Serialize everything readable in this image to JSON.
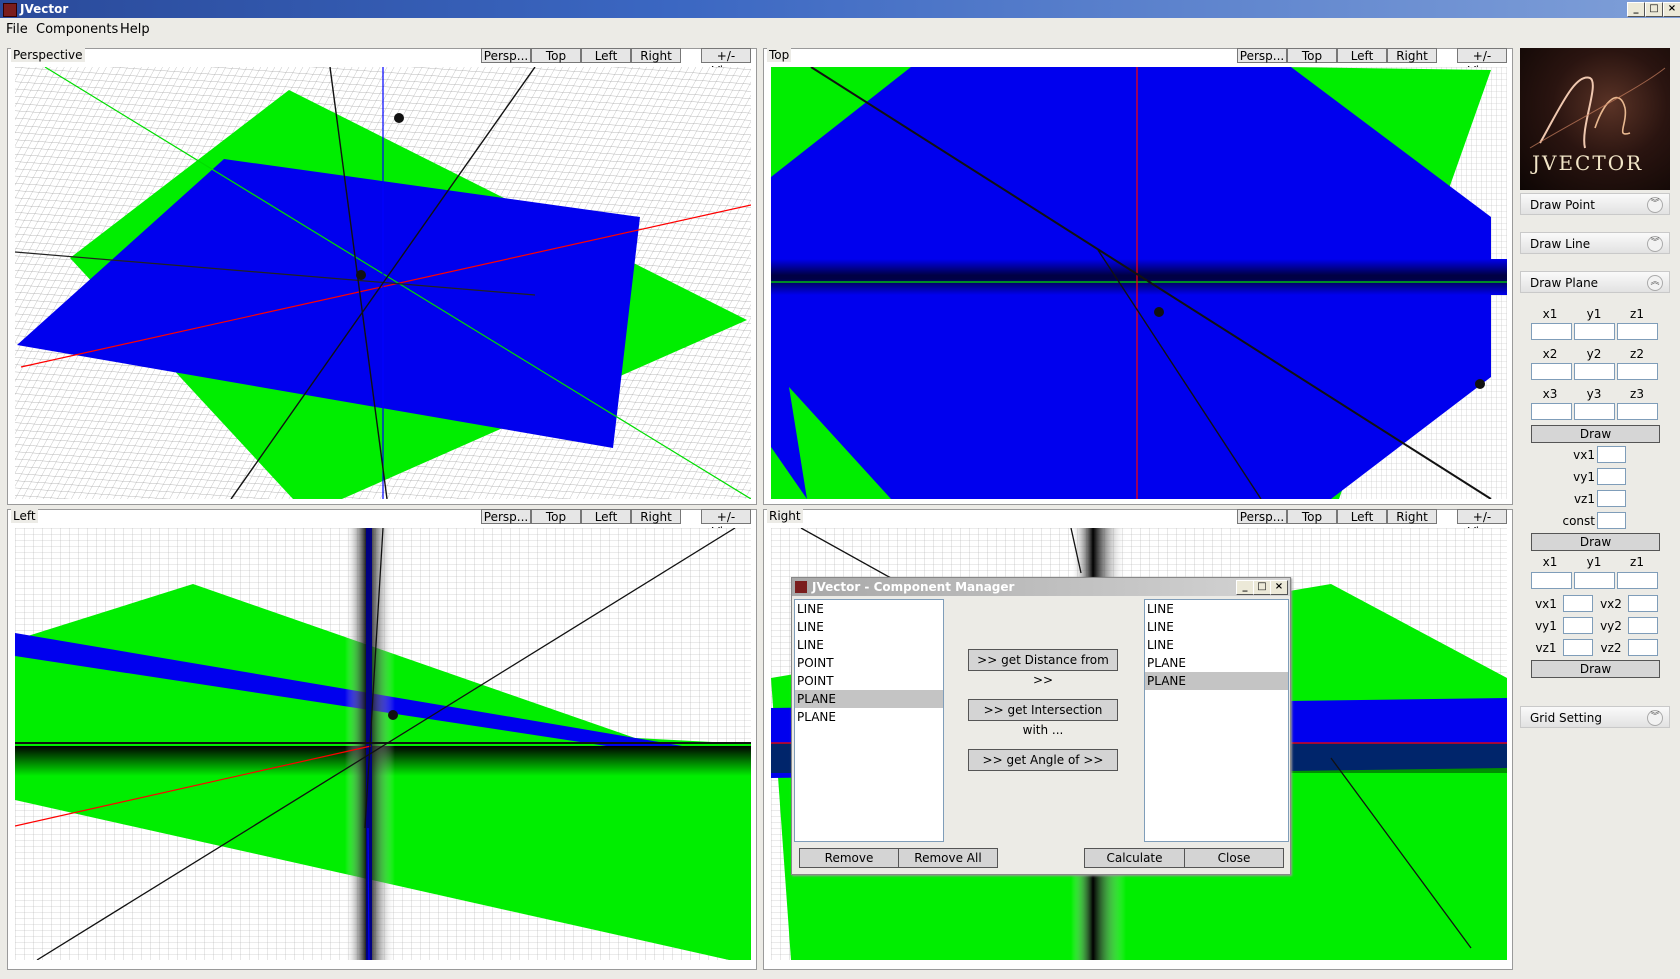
{
  "window": {
    "title": "JVector"
  },
  "menu": [
    "File",
    "Components",
    "Help"
  ],
  "viewports": [
    {
      "label": "Perspective",
      "buttons": [
        "Persp...",
        "Top",
        "Left",
        "Right"
      ],
      "toggle": "+/- View"
    },
    {
      "label": "Top",
      "buttons": [
        "Persp...",
        "Top",
        "Left",
        "Right"
      ],
      "toggle": "+/- View"
    },
    {
      "label": "Left",
      "buttons": [
        "Persp...",
        "Top",
        "Left",
        "Right"
      ],
      "toggle": "+/- View"
    },
    {
      "label": "Right",
      "buttons": [
        "Persp...",
        "Top",
        "Left",
        "Right"
      ],
      "toggle": "+/- View"
    }
  ],
  "sidebar": {
    "logo_text": "JVECTOR",
    "draw_point": "Draw Point",
    "draw_line": "Draw Line",
    "draw_plane": "Draw Plane",
    "grid_setting": "Grid Setting",
    "row1": [
      "x1",
      "y1",
      "z1"
    ],
    "row2": [
      "x2",
      "y2",
      "z2"
    ],
    "row3": [
      "x3",
      "y3",
      "z3"
    ],
    "draw": "Draw",
    "normal": [
      "vx1",
      "vy1",
      "vz1",
      "const"
    ],
    "row_point": [
      "x1",
      "y1",
      "z1"
    ],
    "vec_left": [
      "vx1",
      "vy1",
      "vz1"
    ],
    "vec_right": [
      "vx2",
      "vy2",
      "vz2"
    ]
  },
  "dialog": {
    "title": "JVector - Component Manager",
    "left_list": [
      "LINE",
      "LINE",
      "LINE",
      "POINT",
      "POINT",
      "PLANE",
      "PLANE"
    ],
    "right_list": [
      "LINE",
      "LINE",
      "LINE",
      "PLANE",
      "PLANE"
    ],
    "actions": [
      ">> get Distance from >>",
      ">> get Intersection with ...",
      ">> get Angle of >>"
    ],
    "remove": "Remove",
    "remove_all": "Remove All",
    "calculate": "Calculate",
    "close": "Close"
  },
  "colors": {
    "plane_blue": "#0000ee",
    "plane_green": "#00ee00",
    "axis_red": "#ff0000",
    "axis_green": "#00dd00",
    "axis_blue": "#0000ff"
  }
}
